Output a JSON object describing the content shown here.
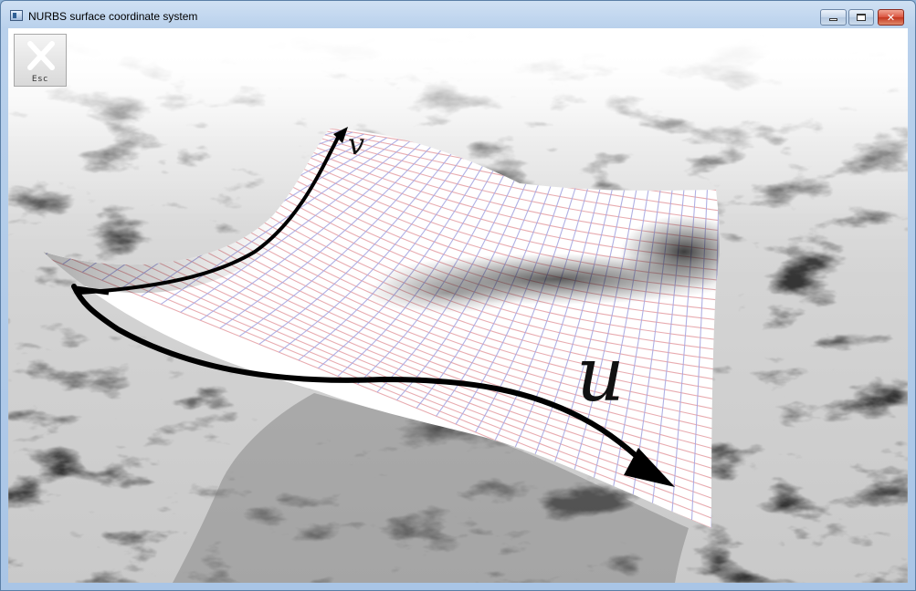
{
  "window": {
    "title": "NURBS surface coordinate system",
    "controls": {
      "minimize": "minimize",
      "maximize": "maximize",
      "close": "close"
    }
  },
  "toolbar": {
    "esc_label": "Esc"
  },
  "surface": {
    "u_label": "u",
    "v_label": "v"
  },
  "icons": {
    "app": "app-window-icon",
    "esc": "close-x-icon"
  },
  "colors": {
    "titlebar": "#b9d1ec",
    "close_button": "#c4361f",
    "grid_u_lines": "#e8a0a0",
    "grid_v_lines": "#a0a0e0",
    "axis_arrows": "#000000"
  }
}
